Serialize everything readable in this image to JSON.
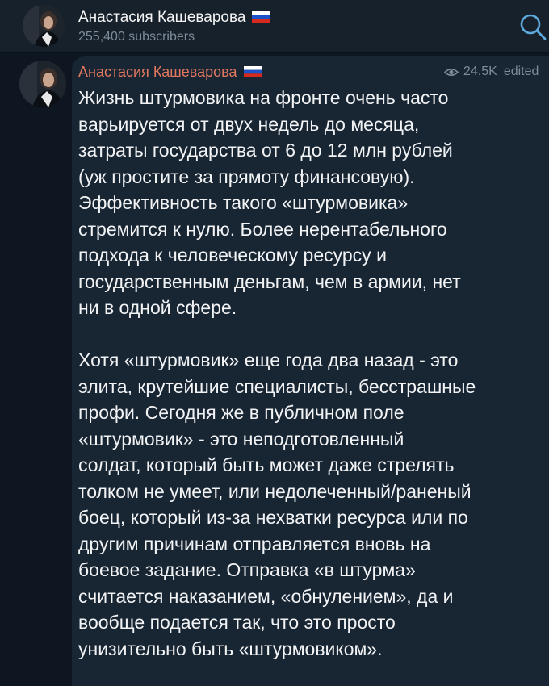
{
  "header": {
    "channel_name": "Анастасия Кашеварова",
    "subscribers": "255,400 subscribers"
  },
  "post": {
    "author": "Анастасия Кашеварова",
    "views": "24.5K",
    "edited": "edited",
    "paragraphs": [
      "Жизнь штурмовика на фронте очень часто\nварьируется от двух недель до месяца,\nзатраты государства от 6 до 12 млн рублей\n(уж простите за прямоту финансовую).\nЭффективность такого «штурмовика»\nстремится к нулю. Более нерентабельного\nподхода к человеческому ресурсу и\nгосударственным деньгам, чем в армии, нет\nни в одной сфере.",
      "Хотя «штурмовик» еще года два назад - это\nэлита, крутейшие специалисты, бесстрашные\nпрофи. Сегодня же в публичном поле\n«штурмовик» - это неподготовленный\nсолдат, который быть может даже стрелять\nтолком не умеет, или недолеченный/раненый\nбоец, который из-за нехватки ресурса или по\nдругим причинам отправляется вновь на\nбоевое задание. Отправка «в штурма»\nсчитается наказанием, «обнулением», да и\nвообще подается так, что это просто\nунизительно быть «штурмовиком»."
    ]
  },
  "icons": {
    "flag": "russia-flag-icon",
    "search": "search-icon",
    "views": "eye-icon"
  },
  "colors": {
    "background": "#0e1621",
    "header": "#17212b",
    "bubble": "#182533",
    "author": "#e0775f",
    "accent": "#5ea9dd",
    "muted": "#7f8b98"
  }
}
